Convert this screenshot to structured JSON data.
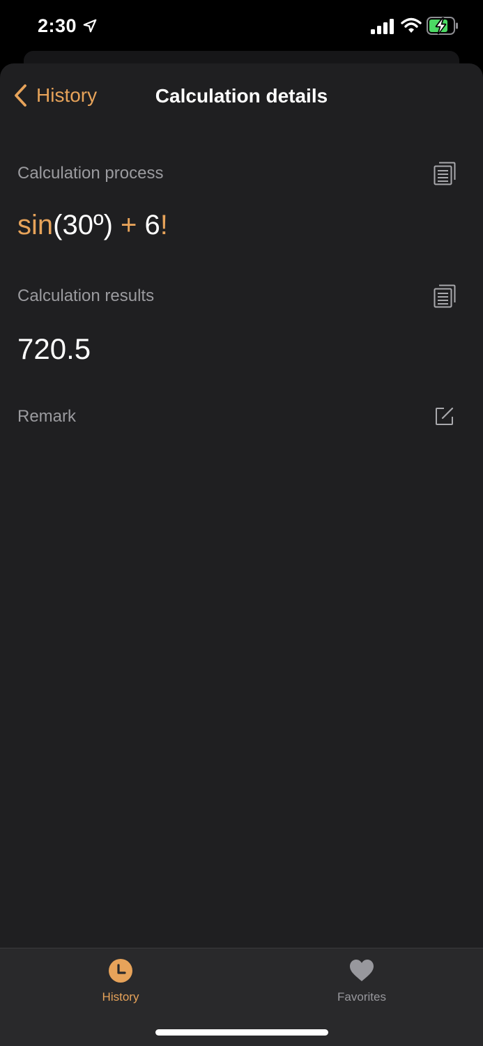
{
  "status_bar": {
    "time": "2:30",
    "icons": [
      "location-arrow-icon",
      "signal-icon",
      "wifi-icon",
      "battery-charging-icon"
    ],
    "battery_color": "#4cd964"
  },
  "nav": {
    "back_label": "History",
    "title": "Calculation details"
  },
  "process": {
    "label": "Calculation process",
    "expression": {
      "fn": "sin",
      "arg": "(30º)",
      "op": "+",
      "num": "6",
      "bang": "!"
    }
  },
  "results": {
    "label": "Calculation results",
    "value": "720.5"
  },
  "remark": {
    "label": "Remark"
  },
  "tab_bar": {
    "tabs": [
      {
        "label": "History",
        "icon": "clock-icon",
        "active": true
      },
      {
        "label": "Favorites",
        "icon": "heart-icon",
        "active": false
      }
    ]
  },
  "colors": {
    "accent": "#e7a35a",
    "background": "#1f1f21",
    "secondary_text": "#9b9b9f",
    "tab_bar": "#29292b"
  }
}
